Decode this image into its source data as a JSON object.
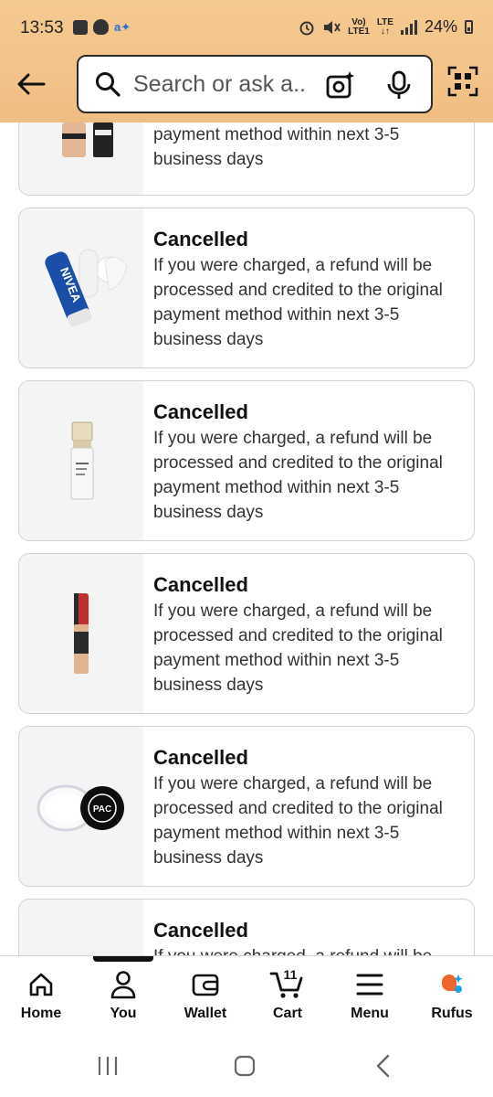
{
  "status_bar": {
    "time": "13:53",
    "volte": "Vo)",
    "lte": "LTE",
    "lte_sub": "LTE1",
    "battery": "24%"
  },
  "search": {
    "placeholder": "Search or ask a..."
  },
  "orders": [
    {
      "status": "",
      "message": "payment method within next 3-5 business days",
      "thumb": "foundation-bottles"
    },
    {
      "status": "Cancelled",
      "message": "If you were charged, a refund will be processed and credited to the original payment method within next 3-5 business days",
      "thumb": "nivea-lip-balm"
    },
    {
      "status": "Cancelled",
      "message": "If you were charged, a refund will be processed and credited to the original payment method within next 3-5 business days",
      "thumb": "serum-bottle"
    },
    {
      "status": "Cancelled",
      "message": "If you were charged, a refund will be processed and credited to the original payment method within next 3-5 business days",
      "thumb": "concealer-tube"
    },
    {
      "status": "Cancelled",
      "message": "If you were charged, a refund will be processed and credited to the original payment method within next 3-5 business days",
      "thumb": "loose-powder-jar"
    },
    {
      "status": "Cancelled",
      "message": "If you were charged, a refund will be",
      "thumb": "blank"
    }
  ],
  "thumb_labels": {
    "nivea": "NIVEA",
    "pac": "PAC"
  },
  "bottom_nav": {
    "home": "Home",
    "you": "You",
    "wallet": "Wallet",
    "cart": "Cart",
    "cart_count": "11",
    "menu": "Menu",
    "rufus": "Rufus"
  },
  "colors": {
    "header_bg": "#f2c38a",
    "active_indicator": "#111111",
    "rufus_orange": "#f0642d",
    "rufus_blue": "#1aa3d8"
  }
}
